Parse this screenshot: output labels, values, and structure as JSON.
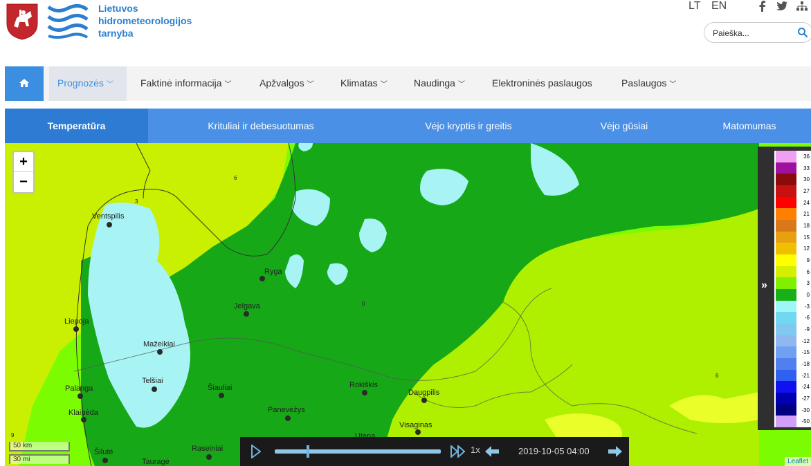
{
  "header": {
    "org_name_lines": [
      "Lietuvos",
      "hidrometeorologijos",
      "tarnyba"
    ],
    "languages": [
      "LT",
      "EN"
    ],
    "social_icons": [
      "facebook-icon",
      "twitter-icon",
      "sitemap-icon"
    ],
    "search_placeholder": "Paieška..."
  },
  "colors": {
    "brand_blue": "#3c8ee0",
    "subnav_blue": "#4a90e6",
    "subnav_active": "#2e7bd4"
  },
  "main_nav": {
    "home_icon": "home-icon",
    "items": [
      {
        "label": "Prognozės",
        "dropdown": true,
        "active": true
      },
      {
        "label": "Faktinė informacija",
        "dropdown": true
      },
      {
        "label": "Apžvalgos",
        "dropdown": true
      },
      {
        "label": "Klimatas",
        "dropdown": true
      },
      {
        "label": "Naudinga",
        "dropdown": true
      },
      {
        "label": "Elektroninės paslaugos",
        "dropdown": false
      },
      {
        "label": "Paslaugos",
        "dropdown": true
      }
    ]
  },
  "sub_nav": {
    "tabs": [
      "Temperatūra",
      "Krituliai ir debesuotumas",
      "Vėjo kryptis ir greitis",
      "Vėjo gūsiai",
      "Matomumas"
    ],
    "active": "Temperatūra"
  },
  "map": {
    "zoom_in": "+",
    "zoom_out": "−",
    "cities": [
      "Ventspilis",
      "Ryga",
      "Jelgava",
      "Liepoja",
      "Mažeikiai",
      "Telšiai",
      "Šiauliai",
      "Palanga",
      "Klaipėda",
      "Panevėžys",
      "Rokiškis",
      "Daugpilis",
      "Visaginas",
      "Utena",
      "Šilutė",
      "Tauragė",
      "Raseiniai"
    ],
    "scale_km": "50 km",
    "scale_mi": "30 mi",
    "attribution": "Leaflet",
    "contour_labels": [
      "6",
      "3",
      "0",
      "9"
    ]
  },
  "legend": {
    "toggle": "»",
    "levels": [
      {
        "value": "36",
        "color": "#f0a0f0"
      },
      {
        "value": "33",
        "color": "#a010a0"
      },
      {
        "value": "30",
        "color": "#8b0a0a"
      },
      {
        "value": "27",
        "color": "#c81010"
      },
      {
        "value": "24",
        "color": "#ff0000"
      },
      {
        "value": "21",
        "color": "#ff8000"
      },
      {
        "value": "18",
        "color": "#d87818"
      },
      {
        "value": "15",
        "color": "#e8a010"
      },
      {
        "value": "12",
        "color": "#f0c000"
      },
      {
        "value": "9",
        "color": "#ffff00"
      },
      {
        "value": "6",
        "color": "#d4f000"
      },
      {
        "value": "3",
        "color": "#80f000"
      },
      {
        "value": "0",
        "color": "#18b018"
      },
      {
        "value": "-3",
        "color": "#9ef6f6"
      },
      {
        "value": "-6",
        "color": "#70d8f0"
      },
      {
        "value": "-9",
        "color": "#80c8f0"
      },
      {
        "value": "-12",
        "color": "#90b8f0"
      },
      {
        "value": "-15",
        "color": "#70a0f0"
      },
      {
        "value": "-18",
        "color": "#5080f0"
      },
      {
        "value": "-21",
        "color": "#3060f0"
      },
      {
        "value": "-24",
        "color": "#1010f0"
      },
      {
        "value": "-27",
        "color": "#0000b0"
      },
      {
        "value": "-30",
        "color": "#000080"
      },
      {
        "value": "-50",
        "color": "#d0a0f8"
      }
    ]
  },
  "player": {
    "speed": "1x",
    "datetime": "2019-10-05 04:00",
    "progress": 0.19
  }
}
